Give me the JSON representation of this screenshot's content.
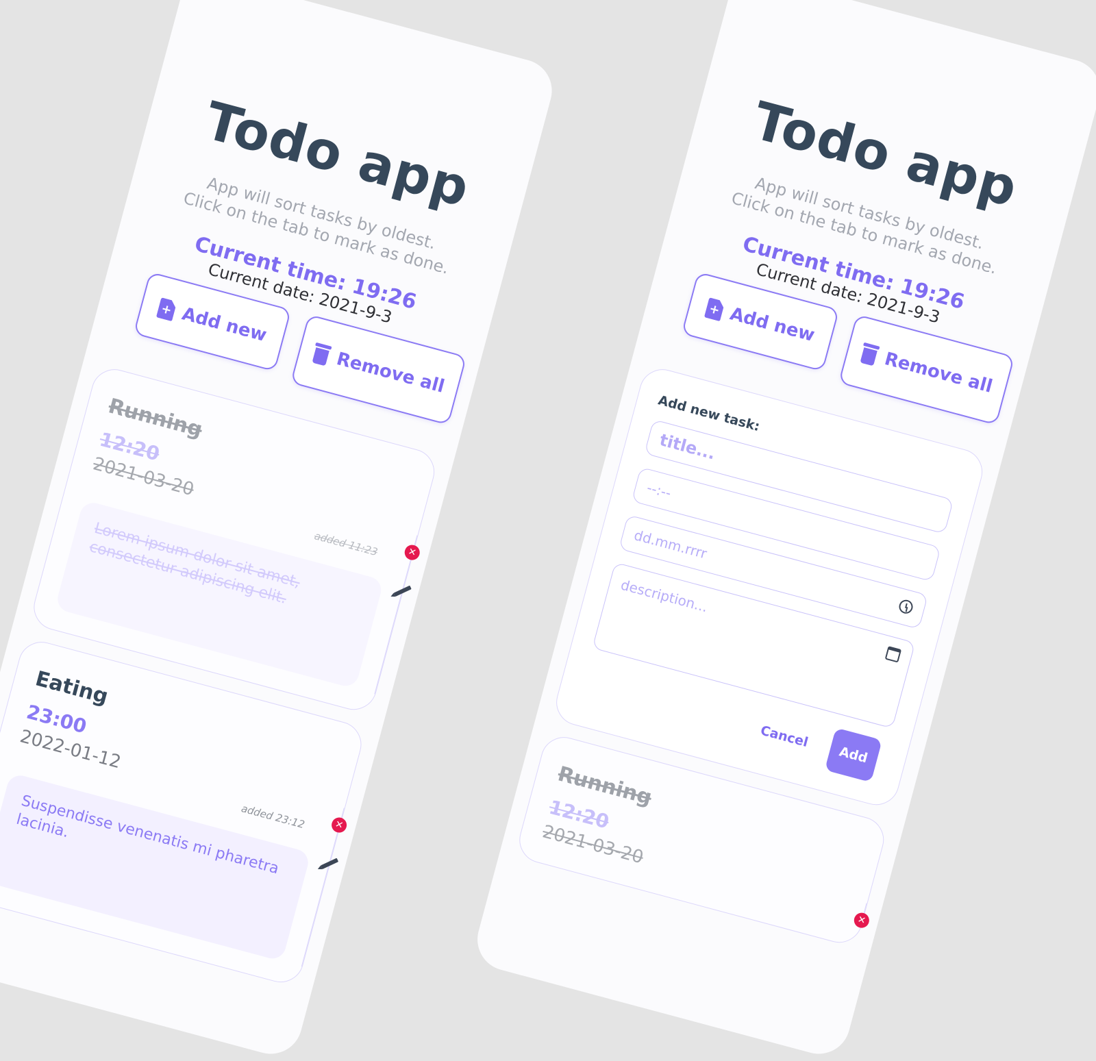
{
  "app": {
    "title": "Todo app",
    "subtitle_line1": "App will sort tasks by oldest.",
    "subtitle_line2": "Click on the tab to mark as done.",
    "current_time": "Current time: 19:26",
    "current_date": "Current date: 2021-9-3"
  },
  "toolbar": {
    "add_new": "Add new",
    "remove_all": "Remove all"
  },
  "tasks": [
    {
      "title": "Running",
      "time": "12:20",
      "date": "2021-03-20",
      "added": "added 11:23",
      "description": "Lorem ipsum dolor sit amet, consectetur adipiscing elit.",
      "done": true
    },
    {
      "title": "Eating",
      "time": "23:00",
      "date": "2022-01-12",
      "added": "added 23:12",
      "description": "Suspendisse venenatis mi pharetra lacinia.",
      "done": false
    }
  ],
  "form": {
    "label": "Add new task:",
    "title_placeholder": "title...",
    "time_placeholder": "--:--",
    "date_placeholder": "dd.mm.rrrr",
    "description_placeholder": "description...",
    "cancel": "Cancel",
    "submit": "Add"
  },
  "icons": {
    "add": "file-plus-icon",
    "remove": "trash-icon",
    "delete": "close-circle-icon",
    "edit": "pencil-icon",
    "time": "clock-icon",
    "date": "calendar-icon"
  },
  "colors": {
    "accent": "#7f6cf1",
    "heading": "#36485a",
    "danger": "#e5194f",
    "background": "#e4e4e4"
  }
}
